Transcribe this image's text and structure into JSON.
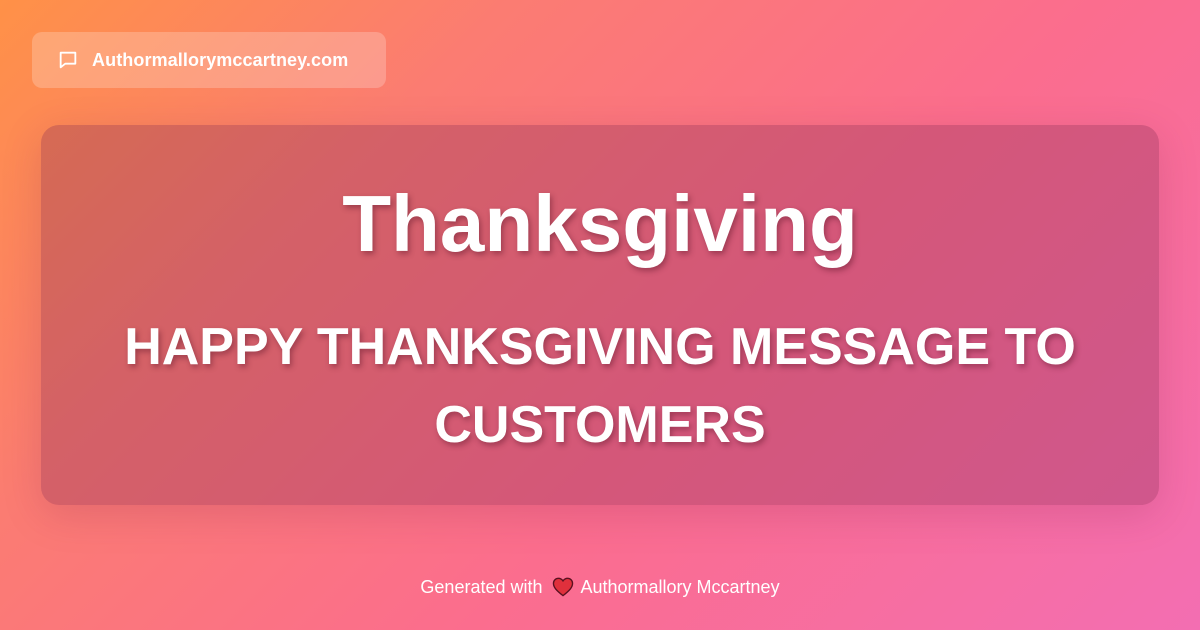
{
  "header": {
    "site_domain": "Authormallorymccartney.com",
    "icon": "chat-bubble-icon"
  },
  "card": {
    "title": "Thanksgiving",
    "subtitle": "HAPPY THANKSGIVING MESSAGE TO CUSTOMERS"
  },
  "footer": {
    "generated_prefix": "Generated with",
    "heart_icon": "heart-icon",
    "author_name": "Authormallory Mccartney"
  },
  "colors": {
    "gradient_start": "#ff9147",
    "gradient_end": "#f36eb2",
    "heart": "#e0303c",
    "text": "#ffffff"
  }
}
